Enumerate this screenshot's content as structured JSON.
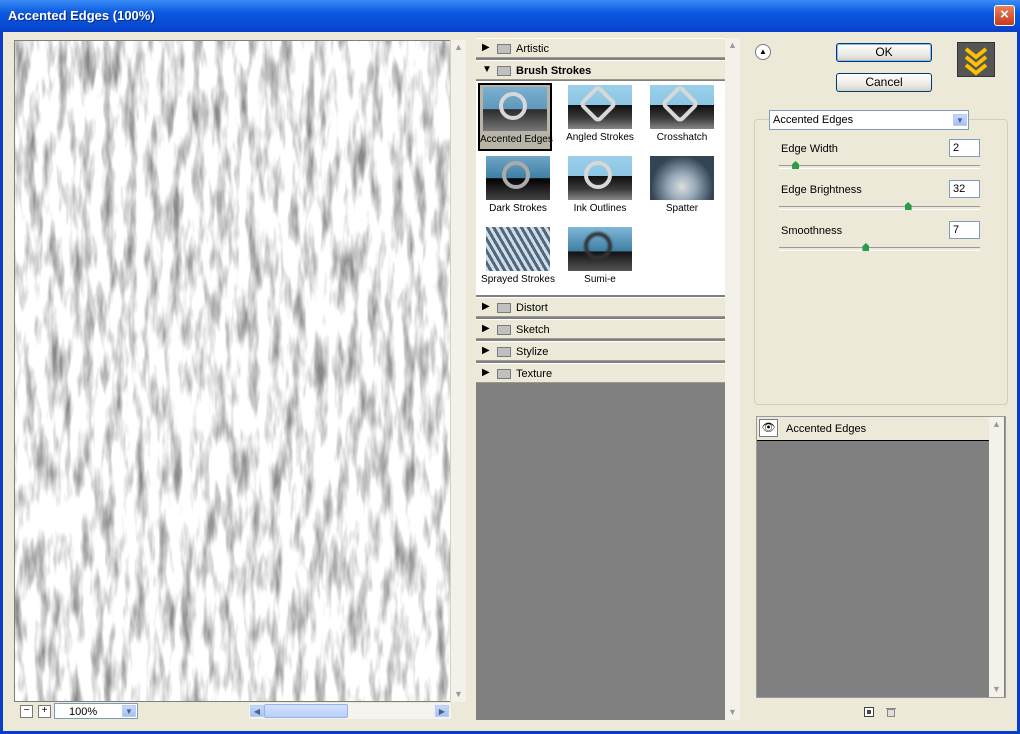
{
  "window": {
    "title": "Accented Edges (100%)",
    "close_glyph": "×"
  },
  "zoom": {
    "minus": "−",
    "plus": "+",
    "value": "100%"
  },
  "categories": [
    {
      "label": "Artistic",
      "expanded": false
    },
    {
      "label": "Brush Strokes",
      "expanded": true
    },
    {
      "label": "Distort",
      "expanded": false
    },
    {
      "label": "Sketch",
      "expanded": false
    },
    {
      "label": "Stylize",
      "expanded": false
    },
    {
      "label": "Texture",
      "expanded": false
    }
  ],
  "brush_filters": [
    {
      "label": "Accented Edges",
      "selected": true
    },
    {
      "label": "Angled Strokes",
      "selected": false
    },
    {
      "label": "Crosshatch",
      "selected": false
    },
    {
      "label": "Dark Strokes",
      "selected": false
    },
    {
      "label": "Ink Outlines",
      "selected": false
    },
    {
      "label": "Spatter",
      "selected": false
    },
    {
      "label": "Sprayed Strokes",
      "selected": false
    },
    {
      "label": "Sumi-e",
      "selected": false
    }
  ],
  "buttons": {
    "ok": "OK",
    "cancel": "Cancel"
  },
  "filter_select": {
    "value": "Accented Edges"
  },
  "params": [
    {
      "label": "Edge Width",
      "value": "2",
      "slider": 0.08
    },
    {
      "label": "Edge Brightness",
      "value": "32",
      "slider": 0.64
    },
    {
      "label": "Smoothness",
      "value": "7",
      "slider": 0.43
    }
  ],
  "layers": [
    {
      "label": "Accented Edges",
      "visible": true
    }
  ],
  "icons": {
    "collapse": "collapse-icon",
    "eye": "eye-icon",
    "new_layer": "new-layer-icon",
    "delete": "trash-icon",
    "folder": "folder-icon"
  }
}
